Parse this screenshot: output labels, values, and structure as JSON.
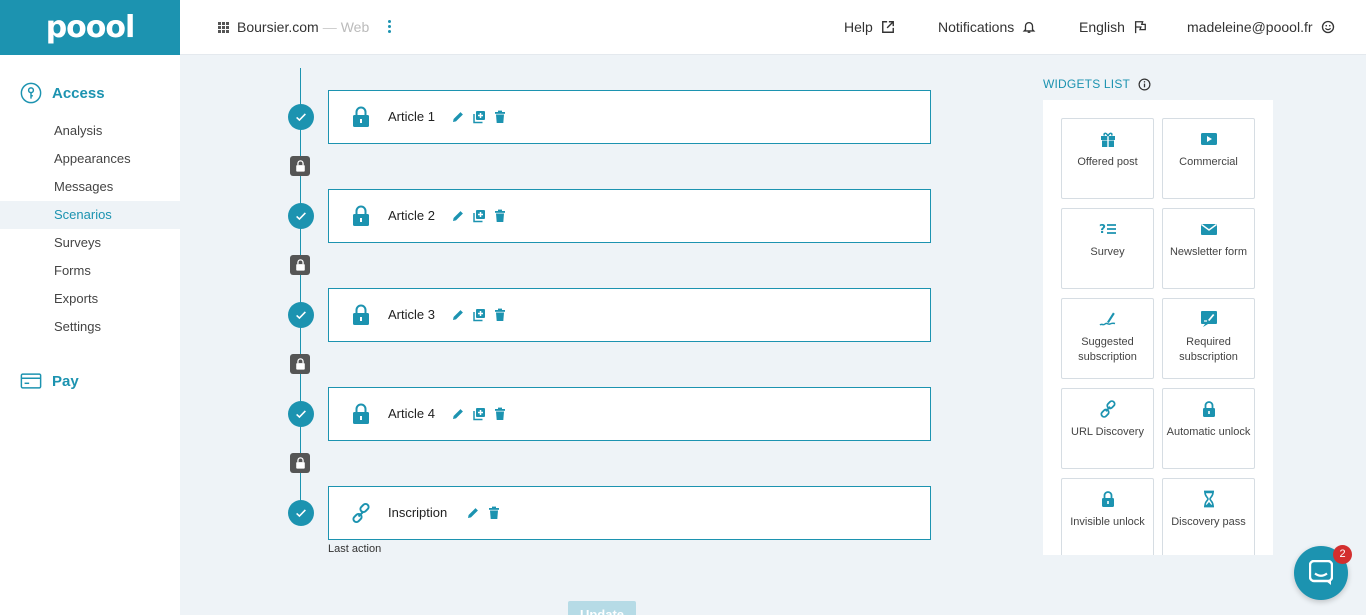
{
  "brand": {
    "logo": "poool",
    "accent": "#1c93b0"
  },
  "header": {
    "site_name": "Boursier.com",
    "site_separator": "—",
    "site_type": "Web",
    "help": "Help",
    "notifications": "Notifications",
    "language": "English",
    "user_email": "madeleine@poool.fr"
  },
  "sidebar": {
    "access_label": "Access",
    "items": [
      "Analysis",
      "Appearances",
      "Messages",
      "Scenarios",
      "Surveys",
      "Forms",
      "Exports",
      "Settings"
    ],
    "active_item": "Scenarios",
    "pay_label": "Pay"
  },
  "scenario": {
    "steps": [
      {
        "label": "Article 1",
        "icon": "lock-icon"
      },
      {
        "label": "Article 2",
        "icon": "lock-icon"
      },
      {
        "label": "Article 3",
        "icon": "lock-icon"
      },
      {
        "label": "Article 4",
        "icon": "lock-icon"
      },
      {
        "label": "Inscription",
        "icon": "link-icon"
      }
    ],
    "last_action_label": "Last action",
    "update_button": "Update"
  },
  "widgets": {
    "title": "WIDGETS LIST",
    "items": [
      {
        "label": "Offered post",
        "icon": "gift-icon"
      },
      {
        "label": "Commercial",
        "icon": "play-icon"
      },
      {
        "label": "Survey",
        "icon": "survey-icon"
      },
      {
        "label": "Newsletter form",
        "icon": "envelope-icon"
      },
      {
        "label": "Suggested subscription",
        "icon": "signature-icon"
      },
      {
        "label": "Required subscription",
        "icon": "sign-document-icon"
      },
      {
        "label": "URL Discovery",
        "icon": "link-icon"
      },
      {
        "label": "Automatic unlock",
        "icon": "lock-icon"
      },
      {
        "label": "Invisible unlock",
        "icon": "lock-icon"
      },
      {
        "label": "Discovery pass",
        "icon": "hourglass-icon"
      }
    ]
  },
  "chat": {
    "badge_count": "2"
  }
}
